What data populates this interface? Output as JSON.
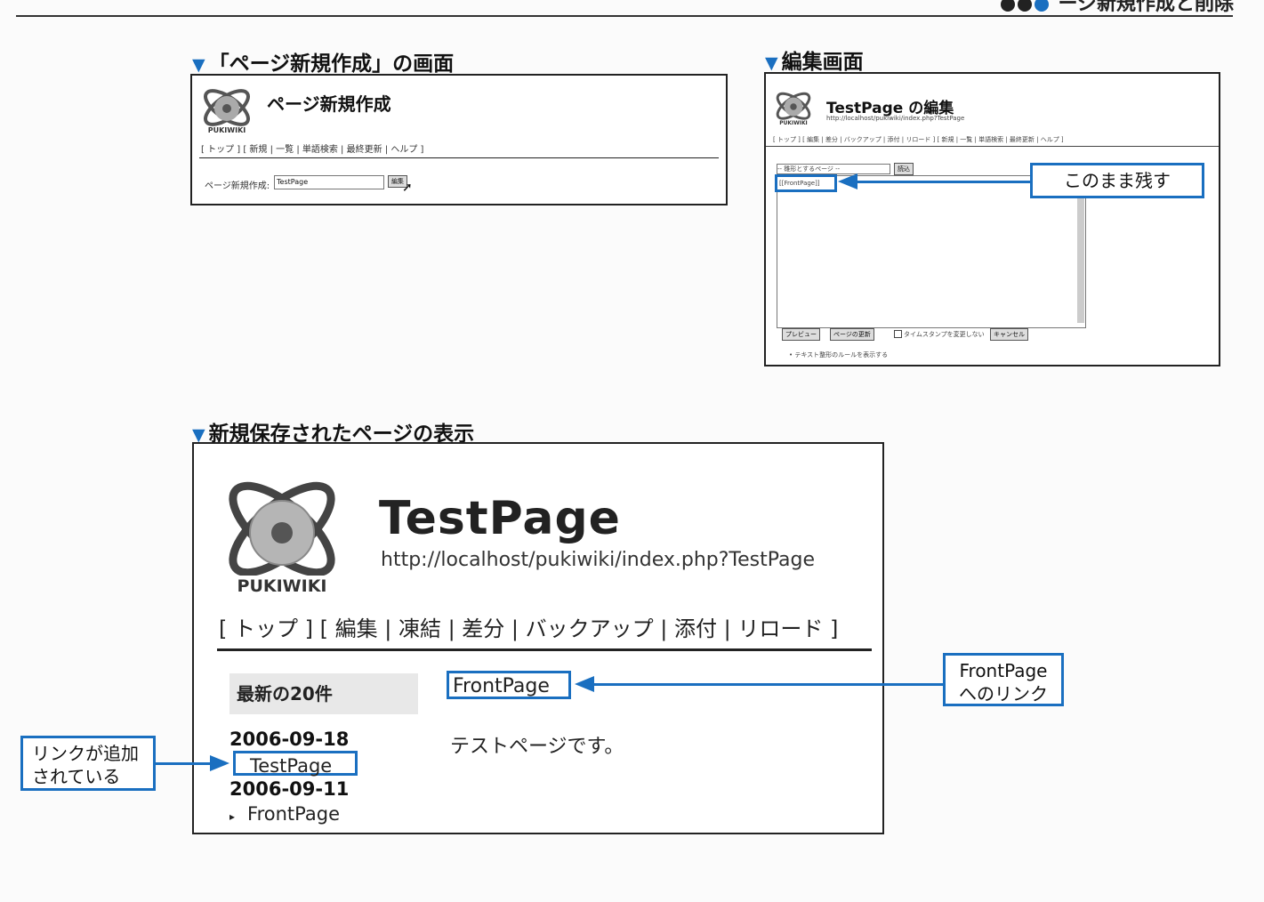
{
  "header": {
    "partial_title": "ージ新規作成と削除"
  },
  "panel1": {
    "caption": "「ページ新規作成」の画面",
    "title": "ページ新規作成",
    "nav": "[ トップ ]  [ 新規 | 一覧 | 単語検索 | 最終更新 | ヘルプ ]",
    "field_label": "ページ新規作成:",
    "field_value": "TestPage",
    "button": "編集"
  },
  "panel2": {
    "caption": "編集画面",
    "title": "TestPage の編集",
    "url": "http://localhost/pukiwiki/index.php?TestPage",
    "nav": "[ トップ ]  [ 編集 | 差分 | バックアップ | 添付 | リロード ]  [ 新規 | 一覧 | 単語検索 | 最終更新 | ヘルプ ]",
    "template_select": "-- 雛形とするページ --",
    "load_button": "読込",
    "textarea_value": "[[FrontPage]]",
    "callout": "このまま残す",
    "preview_button": "プレビュー",
    "update_button": "ページの更新",
    "timestamp_label": "タイムスタンプを変更しない",
    "cancel_button": "キャンセル",
    "rules_link": "テキスト整形のルールを表示する"
  },
  "panel3": {
    "caption": "新規保存されたページの表示",
    "logo_text": "PUKIWIKI",
    "title": "TestPage",
    "url": "http://localhost/pukiwiki/index.php?TestPage",
    "nav": "[ トップ ]  [ 編集 | 凍結 | 差分 | バックアップ | 添付 | リロード ]",
    "recent_title": "最新の20件",
    "date1": "2006-09-18",
    "item1": "TestPage",
    "date2": "2006-09-11",
    "item2": "FrontPage",
    "body_link": "FrontPage",
    "body_text": "テストページです。",
    "callout_right_line1": "FrontPage",
    "callout_right_line2": "へのリンク",
    "callout_left_line1": "リンクが追加",
    "callout_left_line2": "されている"
  }
}
